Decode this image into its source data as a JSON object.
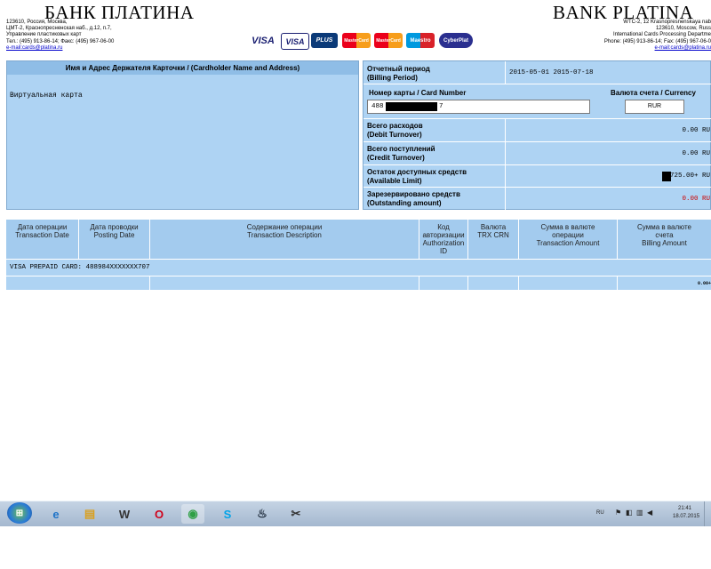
{
  "header": {
    "left_title": "БАНК ПЛАТИНА",
    "left_address": [
      "123610, Россия, Москва,",
      "ЦМТ-2, Краснопресненская наб., д.12, п.7,",
      "Управление пластиковых карт",
      "Тел.: (495) 913-86-14; Факс: (495) 967-06-00"
    ],
    "left_email": "e-mail:cards@platina.ru",
    "right_title": "BANK PLATINA",
    "right_address": [
      "WTC-2, 12 Krasnopresnenskaya nab",
      "123610, Moscow, Russ",
      "International Cards Processing Departme",
      "Phone: (495) 913-86-14; Fax: (495) 967-06-0"
    ],
    "right_email": "e-mail:cards@platina.ru",
    "logos": [
      "VISA",
      "VISA",
      "PLUS",
      "MasterCard",
      "MasterCard",
      "Maestro",
      "CyberPlat"
    ]
  },
  "cardholder": {
    "header": "Имя и Адрес Держателя Карточки / (Cardholder Name and Address)",
    "name": "Виртуальная карта"
  },
  "summary": {
    "billing_period_label": [
      "Отчетный период",
      "(Billing Period)"
    ],
    "billing_period_value": "2015-05-01 2015-07-18",
    "card_number_label": "Номер карты / Card Number",
    "card_number_prefix": "488",
    "card_number_suffix": "7",
    "currency_label": "Валюта счета / Currency",
    "currency_value": "RUR",
    "rows": [
      {
        "label": [
          "Всего расходов",
          "(Debit Turnover)"
        ],
        "value": "0.00 RU",
        "color": "#000000"
      },
      {
        "label": [
          "Всего поступлений",
          "(Credit Turnover)"
        ],
        "value": "0.00 RU",
        "color": "#000000"
      },
      {
        "label": [
          "Остаток доступных средств",
          "(Available Limit)"
        ],
        "value": "725.00+ RU",
        "color": "#000000"
      },
      {
        "label": [
          "Зарезервировано средств",
          "(Outstanding amount)"
        ],
        "value": "0.00 RU",
        "color": "#cc0000"
      }
    ]
  },
  "transactions": {
    "headers": [
      [
        "Дата операции",
        "Transaction Date"
      ],
      [
        "Дата проводки",
        "Posting Date"
      ],
      [
        "Содержание операции",
        "Transaction Description"
      ],
      [
        "Код",
        "авторизации",
        "Authorization",
        "ID"
      ],
      [
        "Валюта",
        "TRX CRN"
      ],
      [
        "Сумма в валюте",
        "операции",
        "Transaction Amount"
      ],
      [
        "Сумма в валюте",
        "счета",
        "Billing Amount"
      ]
    ],
    "card_line": "VISA PREPAID CARD: 488984XXXXXXX707",
    "total": "0.00+"
  },
  "taskbar": {
    "lang": "RU",
    "time": "21:41",
    "date": "18.07.2015"
  }
}
